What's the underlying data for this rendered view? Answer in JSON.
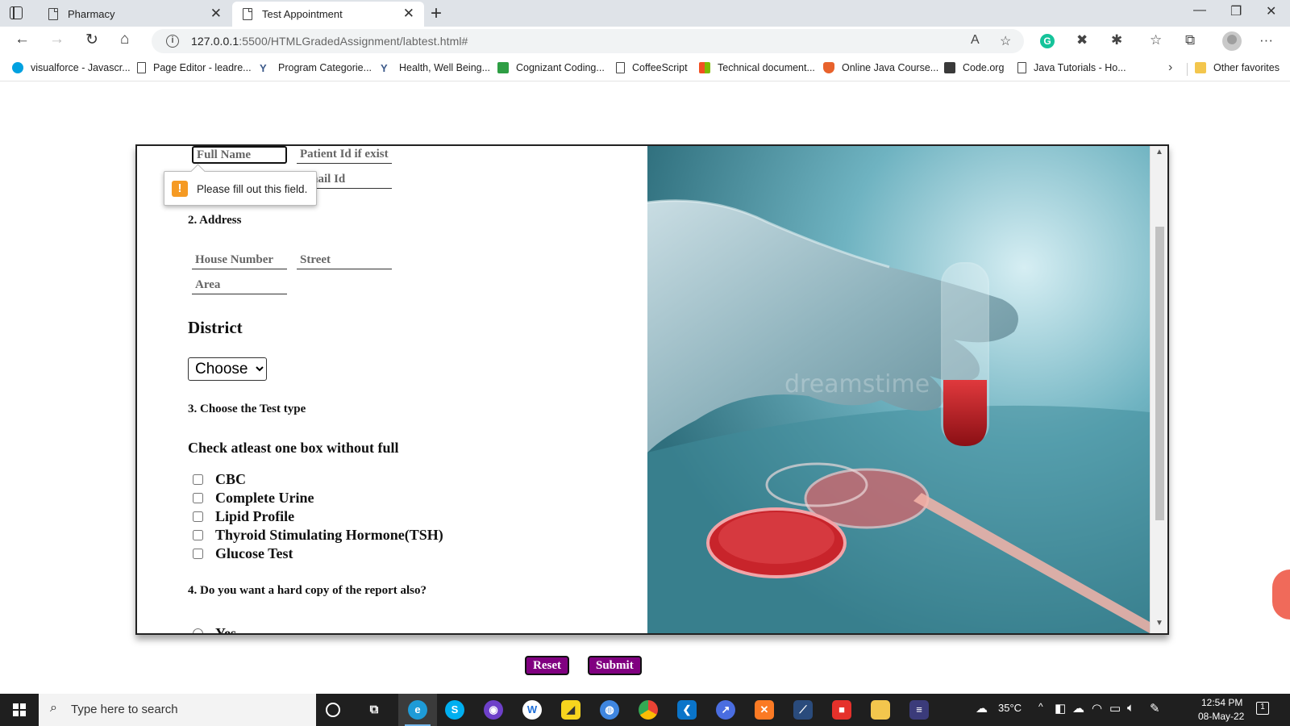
{
  "browser": {
    "tabs": [
      {
        "title": "Pharmacy",
        "active": false
      },
      {
        "title": "Test Appointment",
        "active": true
      }
    ],
    "url": {
      "host": "127.0.0.1",
      "path": ":5500/HTMLGradedAssignment/labtest.html#"
    },
    "favorites": [
      {
        "label": "visualforce - Javascr...",
        "icon": "salesforce-icon",
        "color": "#00a1e0"
      },
      {
        "label": "Page Editor - leadre...",
        "icon": "document-icon"
      },
      {
        "label": "Program Categorie...",
        "icon": "y-logo-icon",
        "color": "#3d5a8a"
      },
      {
        "label": "Health, Well Being...",
        "icon": "y-logo-icon",
        "color": "#3d5a8a"
      },
      {
        "label": "Cognizant Coding...",
        "icon": "green-square-icon",
        "color": "#2e9e44"
      },
      {
        "label": "CoffeeScript",
        "icon": "document-icon"
      },
      {
        "label": "Technical document...",
        "icon": "microsoft-logo-icon"
      },
      {
        "label": "Online Java Course...",
        "icon": "orange-shield-icon",
        "color": "#e8622c"
      },
      {
        "label": "Code.org",
        "icon": "codeorg-icon",
        "color": "#3a3a3a"
      },
      {
        "label": "Java Tutorials - Ho...",
        "icon": "document-icon"
      }
    ],
    "other_favorites": "Other favorites"
  },
  "form": {
    "full_name_placeholder": "Full Name",
    "patient_id_placeholder": "Patient Id if exist",
    "email_placeholder": "Email Id",
    "validation_message": "Please fill out this field.",
    "address_label": "2. Address",
    "house_placeholder": "House Number",
    "street_placeholder": "Street",
    "area_placeholder": "Area",
    "district_heading": "District",
    "district_selected": "Choose",
    "test_type_label": "3. Choose the Test type",
    "check_heading": "Check atleast one box without full",
    "tests": [
      "CBC",
      "Complete Urine",
      "Lipid Profile",
      "Thyroid Stimulating Hormone(TSH)",
      "Glucose Test"
    ],
    "hardcopy_label": "4. Do you want a hard copy of the report also?",
    "yes_label": "Yes",
    "reset_label": "Reset",
    "submit_label": "Submit",
    "button_color": "#800080"
  },
  "image": {
    "watermark": "dreamstime"
  },
  "taskbar": {
    "search_placeholder": "Type here to search",
    "temperature": "35°C",
    "time": "12:54 PM",
    "date": "08-May-22",
    "notifications": "1"
  }
}
